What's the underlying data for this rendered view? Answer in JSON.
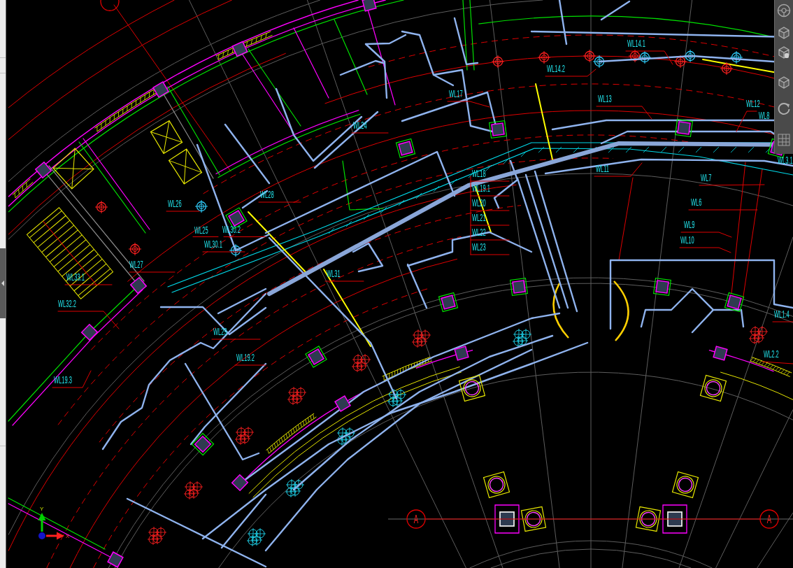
{
  "drawing": {
    "pipe_labels": [
      "WL14.1",
      "WL14.2",
      "WL13",
      "WL12",
      "WL8",
      "WL3.1",
      "WL11",
      "WL7",
      "WL6",
      "WL9",
      "WL10",
      "WL17",
      "WL24",
      "WL18",
      "WL19.1",
      "WL20",
      "WL21",
      "WL22",
      "WL23",
      "WL28",
      "WL26",
      "WL25",
      "WL30.2",
      "WL30.1",
      "WL27",
      "WL31",
      "WL33.1",
      "WL32.2",
      "WL29",
      "WL19.2",
      "WL19.3",
      "WL1.4",
      "WL2.2"
    ],
    "grid_bubbles": [
      "A",
      "A"
    ],
    "axis_icon": {
      "x_label": "X",
      "y_label": "Y"
    }
  }
}
